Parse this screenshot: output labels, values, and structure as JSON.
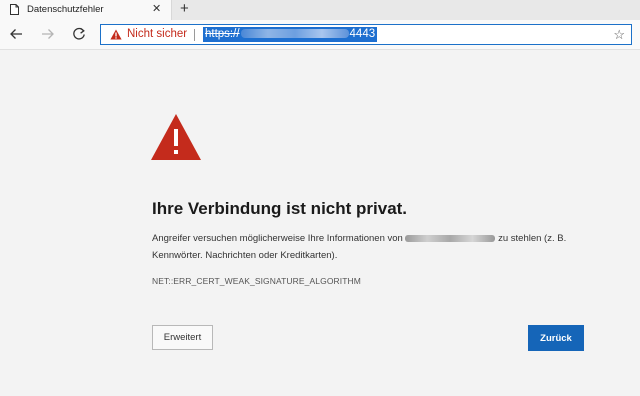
{
  "tab": {
    "title": "Datenschutzfehler",
    "icon": "page-icon",
    "close_label": "✕",
    "new_tab_label": "+"
  },
  "toolbar": {
    "back_icon": "arrow-left-icon",
    "forward_icon": "arrow-right-icon",
    "refresh_icon": "refresh-icon",
    "security_label": "Nicht sicher",
    "url_scheme": "https://",
    "url_port": "4443",
    "favorite_icon": "star-icon",
    "favorite_label": "☆"
  },
  "page": {
    "heading": "Ihre Verbindung ist nicht privat.",
    "description_before": "Angreifer versuchen möglicherweise Ihre Informationen von ",
    "description_after": " zu stehlen (z. B. Kennwörter. Nachrichten oder Kreditkarten).",
    "error_code": "NET::ERR_CERT_WEAK_SIGNATURE_ALGORITHM",
    "advanced_button": "Erweitert",
    "back_button": "Zurück"
  },
  "colors": {
    "warning_red": "#c42b1c",
    "accent_blue": "#1565b8"
  }
}
